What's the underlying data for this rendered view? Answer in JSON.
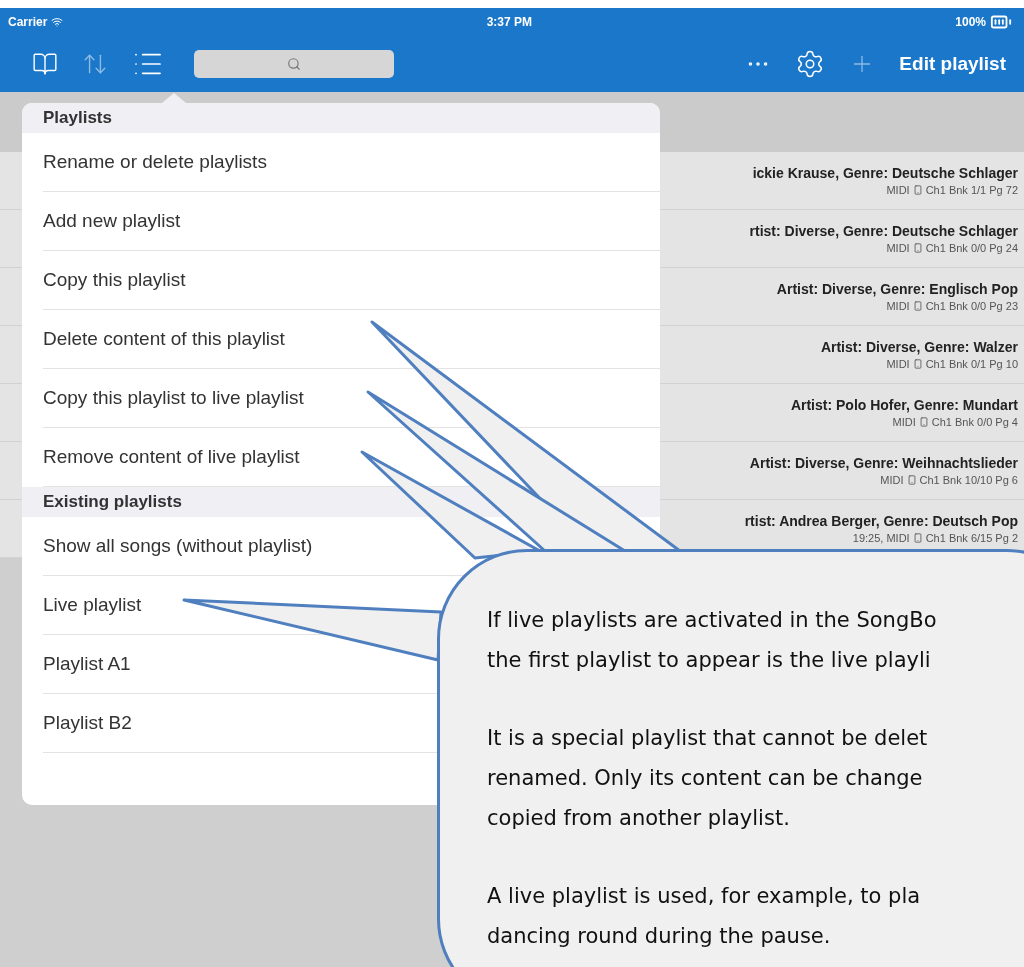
{
  "status_bar": {
    "carrier": "Carrier",
    "time": "3:37 PM",
    "battery": "100%"
  },
  "toolbar": {
    "edit_button": "Edit playlist"
  },
  "songs": [
    {
      "title": "ickie Krause, Genre: Deutsche Schlager",
      "prefix": "MIDI",
      "detail": "Ch1 Bnk 1/1 Pg 72"
    },
    {
      "title": "rtist: Diverse, Genre: Deutsche Schlager",
      "prefix": "MIDI",
      "detail": "Ch1 Bnk 0/0 Pg 24"
    },
    {
      "title": "Artist: Diverse, Genre: Englisch Pop",
      "prefix": "MIDI",
      "detail": "Ch1 Bnk 0/0 Pg 23"
    },
    {
      "title": "Artist: Diverse, Genre: Walzer",
      "prefix": "MIDI",
      "detail": "Ch1 Bnk 0/1 Pg 10"
    },
    {
      "title": "Artist: Polo Hofer, Genre: Mundart",
      "prefix": "MIDI",
      "detail": "Ch1 Bnk 0/0 Pg 4"
    },
    {
      "title": "Artist: Diverse, Genre: Weihnachtslieder",
      "prefix": "MIDI",
      "detail": "Ch1 Bnk 10/10 Pg 6"
    },
    {
      "title": "rtist: Andrea Berger, Genre: Deutsch Pop",
      "prefix": "19:25, MIDI",
      "detail": "Ch1 Bnk 6/15 Pg 2"
    }
  ],
  "menu": {
    "sections": [
      {
        "header": "Playlists",
        "items": [
          "Rename or delete playlists",
          "Add new playlist",
          "Copy this playlist",
          "Delete content of this playlist",
          "Copy this playlist to live playlist",
          "Remove content of live playlist"
        ]
      },
      {
        "header": "Existing playlists",
        "items": [
          "Show all songs (without playlist)",
          "Live playlist",
          "Playlist A1",
          "Playlist B2"
        ]
      }
    ]
  },
  "callout": {
    "paragraphs": [
      [
        "If live playlists are activated in the SongBo",
        "the first playlist to appear is the live playli"
      ],
      [
        "It is a special playlist that cannot be delet",
        "renamed. Only its content can be change",
        "copied from another playlist."
      ],
      [
        "A live playlist is used, for example, to pla",
        "dancing round during the pause."
      ]
    ]
  }
}
